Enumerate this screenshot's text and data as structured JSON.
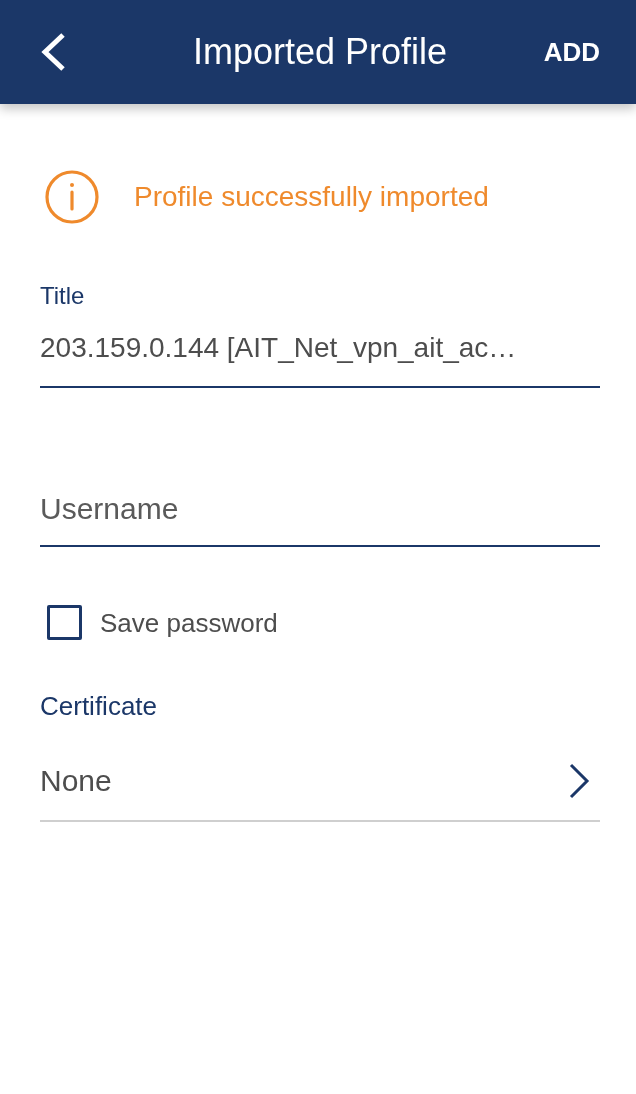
{
  "header": {
    "title": "Imported Profile",
    "action": "ADD"
  },
  "notice": {
    "kind": "info",
    "text": "Profile successfully imported"
  },
  "fields": [
    {
      "kind": "text",
      "label": "Title",
      "value": "203.159.0.144 [AIT_Net_vpn_ait_ac…"
    },
    {
      "kind": "text",
      "placeholder": "Username"
    },
    {
      "kind": "checkbox",
      "label": "Save password",
      "checked": false
    },
    {
      "kind": "select",
      "label": "Certificate",
      "value": "None"
    }
  ]
}
